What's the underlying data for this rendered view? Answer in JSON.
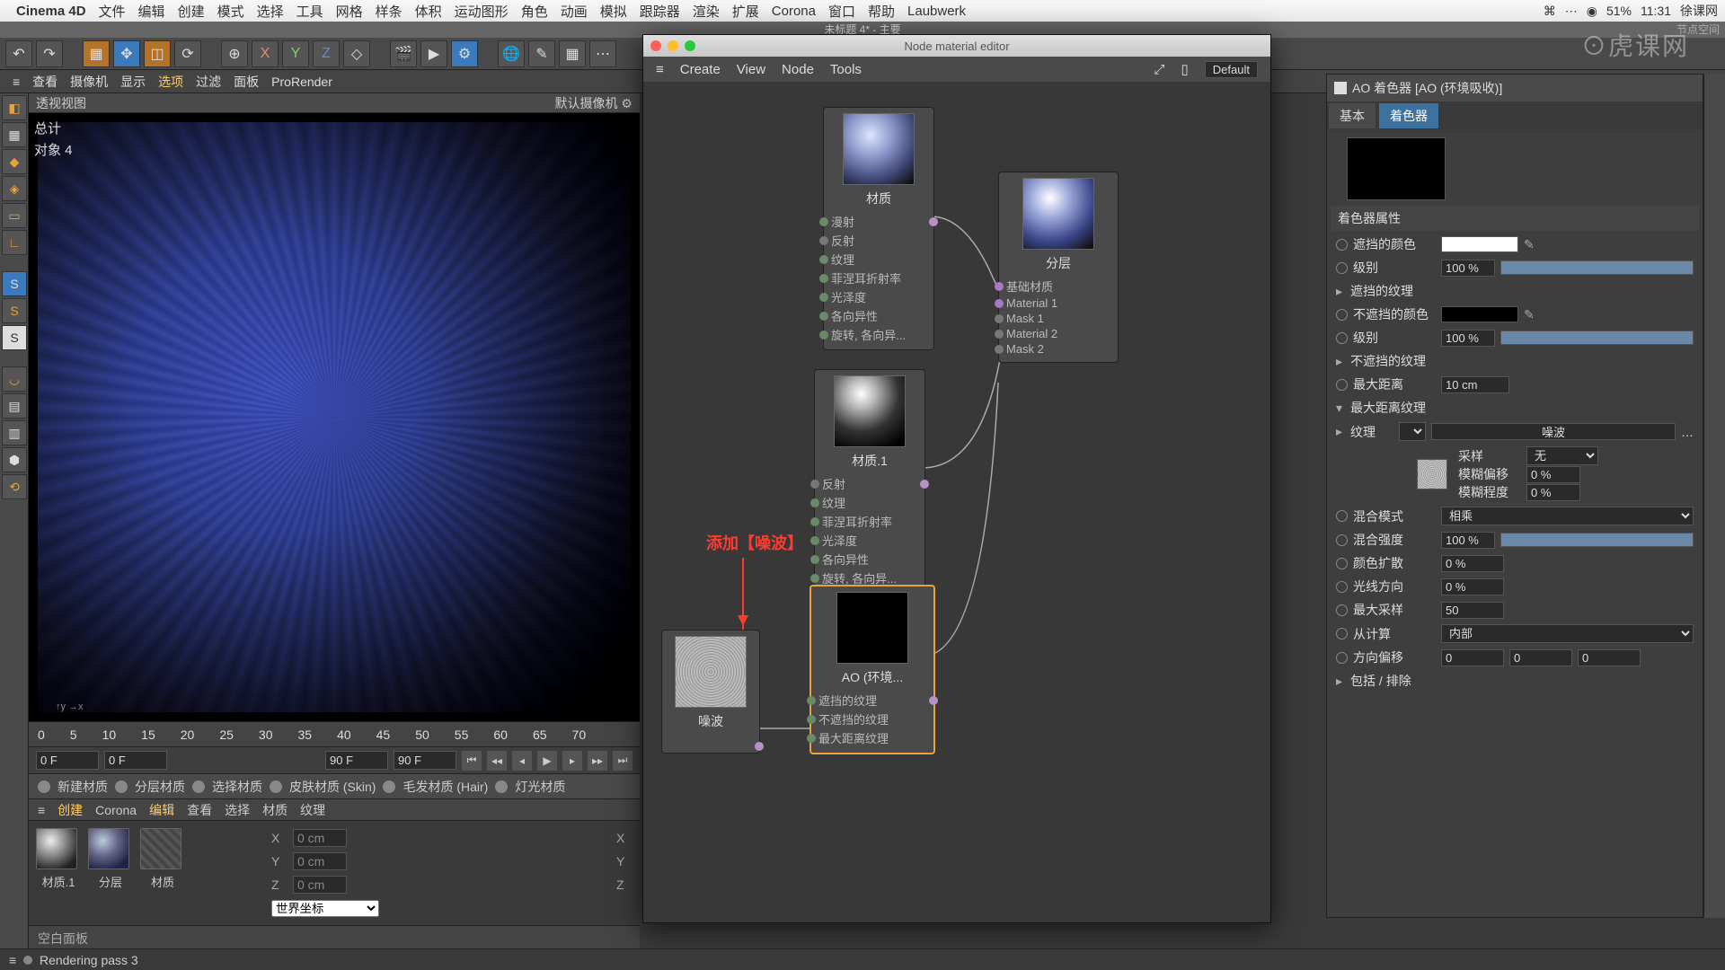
{
  "mac": {
    "app": "Cinema 4D",
    "menus": [
      "文件",
      "编辑",
      "创建",
      "模式",
      "选择",
      "工具",
      "网格",
      "样条",
      "体积",
      "运动图形",
      "角色",
      "动画",
      "模拟",
      "跟踪器",
      "渲染",
      "扩展",
      "Corona",
      "窗口",
      "帮助",
      "Laubwerk"
    ],
    "status": {
      "battery": "51%",
      "time": "11:31",
      "user": "徐课网"
    }
  },
  "win_title": "未标题 4* - 主要",
  "win_title_right": "节点空间",
  "subbar": [
    "查看",
    "摄像机",
    "显示",
    "选项",
    "过滤",
    "面板",
    "ProRender"
  ],
  "viewport": {
    "title": "透视视图",
    "cam": "默认摄像机 ⚙",
    "stats_total": "总计",
    "stats_objs": "对象  4"
  },
  "timeline_ticks": [
    "0",
    "5",
    "10",
    "15",
    "20",
    "25",
    "30",
    "35",
    "40",
    "45",
    "50",
    "55",
    "60",
    "65",
    "70"
  ],
  "play": {
    "a": "0 F",
    "b": "0 F",
    "c": "90 F",
    "d": "90 F"
  },
  "matbar": [
    "新建材质",
    "分层材质",
    "选择材质",
    "皮肤材质 (Skin)",
    "毛发材质 (Hair)",
    "灯光材质"
  ],
  "mat_tabs": [
    "创建",
    "Corona",
    "编辑",
    "查看",
    "选择",
    "材质",
    "纹理"
  ],
  "materials": [
    "材质.1",
    "分层",
    "材质"
  ],
  "coord": {
    "x": "0 cm",
    "y": "0 cm",
    "z": "0 cm",
    "sys": "世界坐标"
  },
  "blank": "空白面板",
  "status_text": "Rendering pass 3",
  "nodewin": {
    "title": "Node material editor",
    "menus": [
      "Create",
      "View",
      "Node",
      "Tools"
    ],
    "dropdown": "Default"
  },
  "nodes": {
    "mat1": {
      "title": "材质",
      "ports": [
        "漫射",
        "反射",
        "纹理",
        "菲涅耳折射率",
        "光泽度",
        "各向异性",
        "旋转, 各向异..."
      ]
    },
    "layer": {
      "title": "分层",
      "ports": [
        "基础材质",
        "Material 1",
        "Mask 1",
        "Material 2",
        "Mask 2"
      ]
    },
    "mat2": {
      "title": "材质.1",
      "ports": [
        "反射",
        "纹理",
        "菲涅耳折射率",
        "光泽度",
        "各向异性",
        "旋转, 各向异..."
      ]
    },
    "ao": {
      "title": "AO (环境...",
      "ports": [
        "遮挡的纹理",
        "不遮挡的纹理",
        "最大距离纹理"
      ]
    },
    "noise": {
      "title": "噪波"
    }
  },
  "note": "添加【噪波】",
  "panel": {
    "title": "AO 着色器 [AO (环境吸收)]",
    "tabs": [
      "基本",
      "着色器"
    ],
    "sect_props": "着色器属性",
    "occluded_color": "遮挡的颜色",
    "level": "级别",
    "level_val": "100 %",
    "occluded_tex": "遮挡的纹理",
    "unoccluded_color": "不遮挡的颜色",
    "level2": "级别",
    "level2_val": "100 %",
    "unoccluded_tex": "不遮挡的纹理",
    "max_dist": "最大距离",
    "max_dist_val": "10 cm",
    "max_dist_tex": "最大距离纹理",
    "texture": "纹理",
    "texture_val": "噪波",
    "sample": "采样",
    "sample_val": "无",
    "blur_off": "模糊偏移",
    "blur_off_val": "0 %",
    "blur_amt": "模糊程度",
    "blur_amt_val": "0 %",
    "mix_mode": "混合模式",
    "mix_mode_val": "相乘",
    "mix_strength": "混合强度",
    "mix_strength_val": "100 %",
    "color_spread": "颜色扩散",
    "color_spread_val": "0 %",
    "light_dir": "光线方向",
    "light_dir_val": "0 %",
    "max_samp": "最大采样",
    "max_samp_val": "50",
    "from_calc": "从计算",
    "from_calc_val": "内部",
    "dir_off": "方向偏移",
    "dir_off_v": [
      "0",
      "0",
      "0"
    ],
    "incl_excl": "包括 / 排除"
  },
  "wm": "⊙虎课网"
}
